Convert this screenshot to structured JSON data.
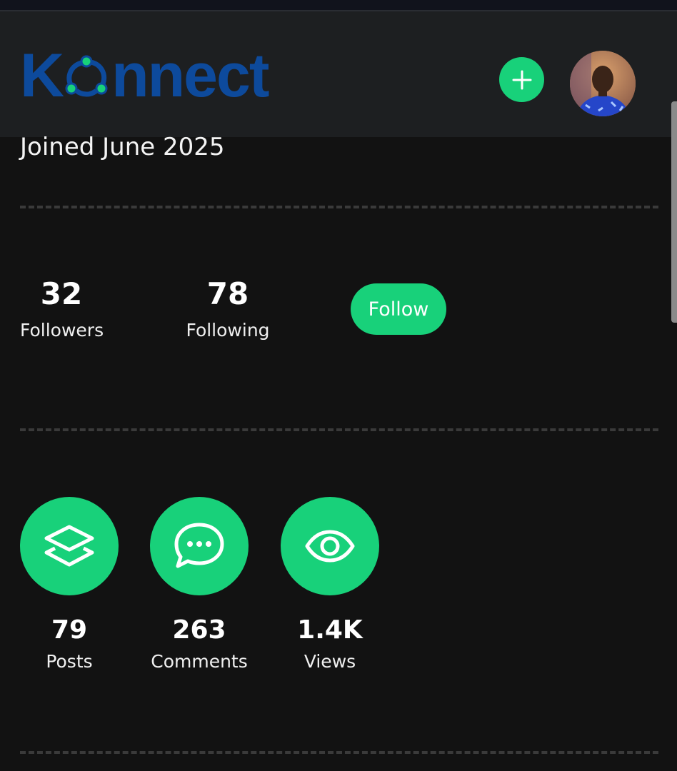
{
  "header": {
    "logo_text": "Konnect",
    "logo_prefix": "K",
    "logo_suffix": "nnect",
    "brand_color": "#0d4a9c",
    "accent_color": "#18d17a"
  },
  "profile": {
    "joined": "Joined June 2025",
    "followers": {
      "count": "32",
      "label": "Followers"
    },
    "following": {
      "count": "78",
      "label": "Following"
    },
    "follow_button": "Follow"
  },
  "activity": [
    {
      "icon": "layers-icon",
      "count": "79",
      "label": "Posts"
    },
    {
      "icon": "chat-bubble-icon",
      "count": "263",
      "label": "Comments"
    },
    {
      "icon": "eye-icon",
      "count": "1.4K",
      "label": "Views"
    }
  ]
}
